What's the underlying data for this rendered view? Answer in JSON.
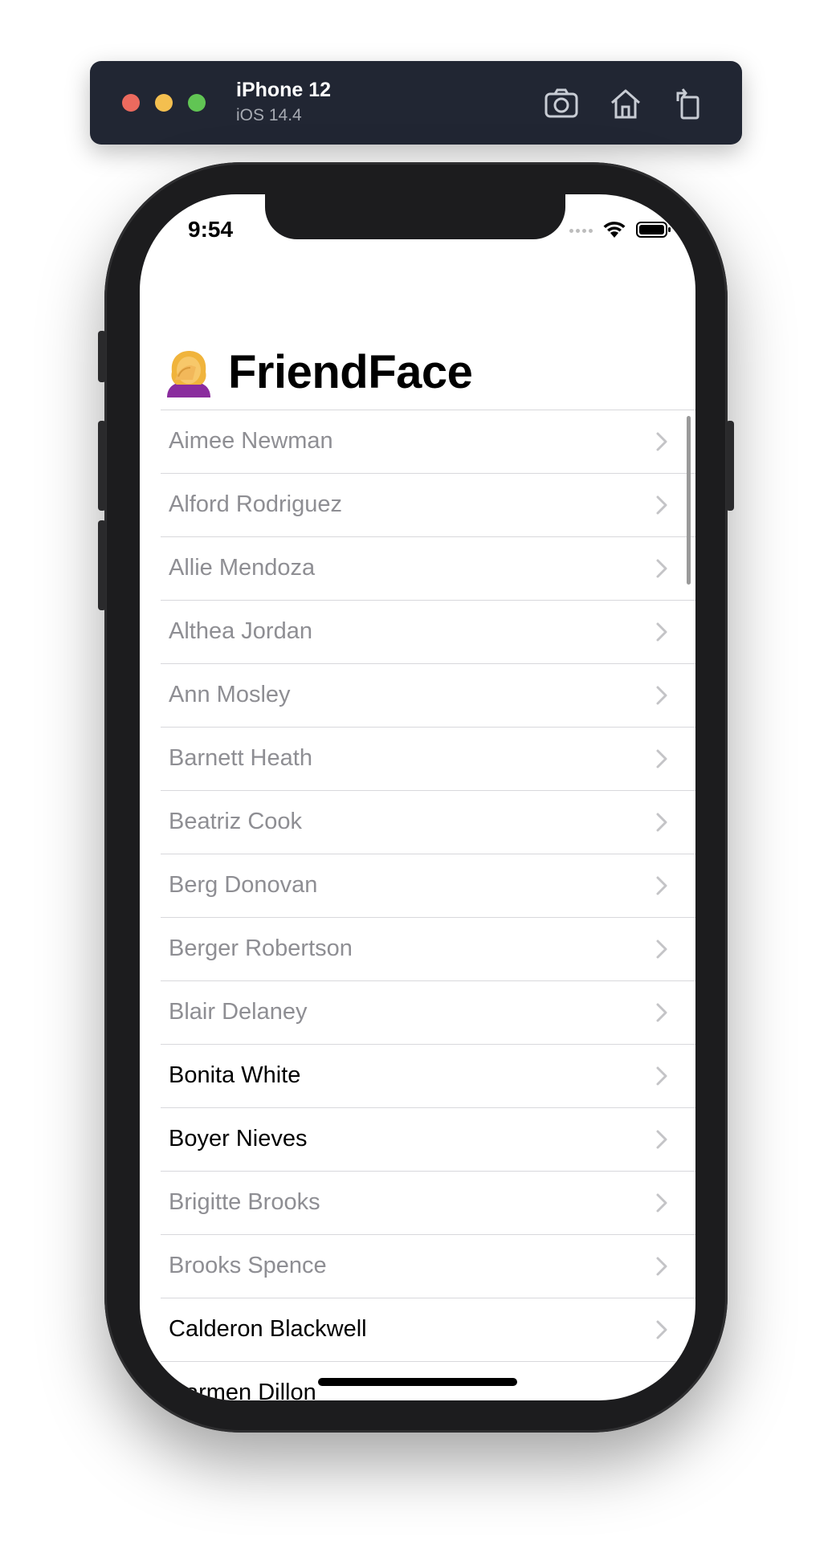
{
  "simulator": {
    "device_name": "iPhone 12",
    "os_version": "iOS 14.4",
    "buttons": [
      "screenshot-icon",
      "home-icon",
      "rotate-icon"
    ]
  },
  "status_bar": {
    "time": "9:54",
    "icons": [
      "cellular-icon",
      "wifi-icon",
      "battery-icon"
    ]
  },
  "app": {
    "title": "FriendFace",
    "title_icon": "face-palm-emoji"
  },
  "friends": [
    {
      "name": "Aimee Newman",
      "active": false
    },
    {
      "name": "Alford Rodriguez",
      "active": false
    },
    {
      "name": "Allie Mendoza",
      "active": false
    },
    {
      "name": "Althea Jordan",
      "active": false
    },
    {
      "name": "Ann Mosley",
      "active": false
    },
    {
      "name": "Barnett Heath",
      "active": false
    },
    {
      "name": "Beatriz Cook",
      "active": false
    },
    {
      "name": "Berg Donovan",
      "active": false
    },
    {
      "name": "Berger Robertson",
      "active": false
    },
    {
      "name": "Blair Delaney",
      "active": false
    },
    {
      "name": "Bonita White",
      "active": true
    },
    {
      "name": "Boyer Nieves",
      "active": true
    },
    {
      "name": "Brigitte Brooks",
      "active": false
    },
    {
      "name": "Brooks Spence",
      "active": false
    },
    {
      "name": "Calderon Blackwell",
      "active": true
    },
    {
      "name": "Carmen Dillon",
      "active": true
    }
  ],
  "colors": {
    "inactive_text": "#8e8e93",
    "active_text": "#000000",
    "separator": "#d8d8dc",
    "chevron": "#c4c4c7"
  }
}
